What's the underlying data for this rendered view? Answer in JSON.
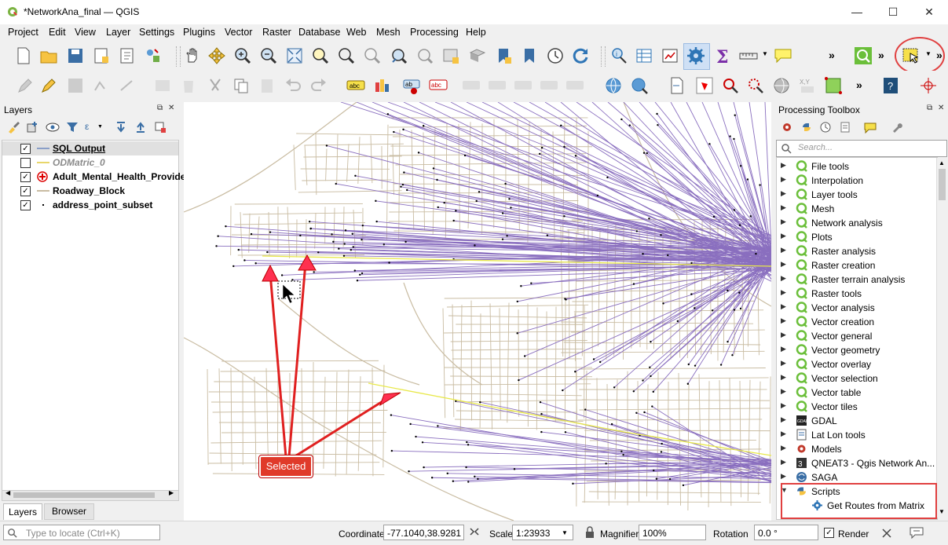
{
  "window": {
    "title": "*NetworkAna_final — QGIS"
  },
  "menu": [
    "Project",
    "Edit",
    "View",
    "Layer",
    "Settings",
    "Plugins",
    "Vector",
    "Raster",
    "Database",
    "Web",
    "Mesh",
    "Processing",
    "Help"
  ],
  "layers_panel": {
    "title": "Layers",
    "layers": [
      {
        "name": "SQL Output",
        "checked": true,
        "style": "bold-underline"
      },
      {
        "name": "ODMatric_0",
        "checked": false,
        "style": "italic"
      },
      {
        "name": "Adult_Mental_Health_Provide",
        "checked": true,
        "style": "bold"
      },
      {
        "name": "Roadway_Block",
        "checked": true,
        "style": "bold"
      },
      {
        "name": "address_point_subset",
        "checked": true,
        "style": "bold"
      }
    ],
    "tabs": [
      "Layers",
      "Browser"
    ]
  },
  "toolbox": {
    "title": "Processing Toolbox",
    "search_placeholder": "Search...",
    "items": [
      "File tools",
      "Interpolation",
      "Layer tools",
      "Mesh",
      "Network analysis",
      "Plots",
      "Raster analysis",
      "Raster creation",
      "Raster terrain analysis",
      "Raster tools",
      "Vector analysis",
      "Vector creation",
      "Vector general",
      "Vector geometry",
      "Vector overlay",
      "Vector selection",
      "Vector table",
      "Vector tiles",
      "GDAL",
      "Lat Lon tools",
      "Models",
      "QNEAT3 - Qgis Network An...",
      "SAGA",
      "Scripts"
    ],
    "script_child": "Get Routes from Matrix"
  },
  "annotation": {
    "label": "Selected"
  },
  "statusbar": {
    "locate_placeholder": "Type to locate (Ctrl+K)",
    "coordinate_label": "Coordinate",
    "coordinate_value": "-77.1040,38.9281",
    "scale_label": "Scale",
    "scale_value": "1:23933",
    "magnifier_label": "Magnifier",
    "magnifier_value": "100%",
    "rotation_label": "Rotation",
    "rotation_value": "0.0 °",
    "render_label": "Render"
  },
  "colors": {
    "route": "#8a6fbf",
    "road": "#c9bca2",
    "highlight": "#e8e84a",
    "annotation": "#e02020"
  }
}
